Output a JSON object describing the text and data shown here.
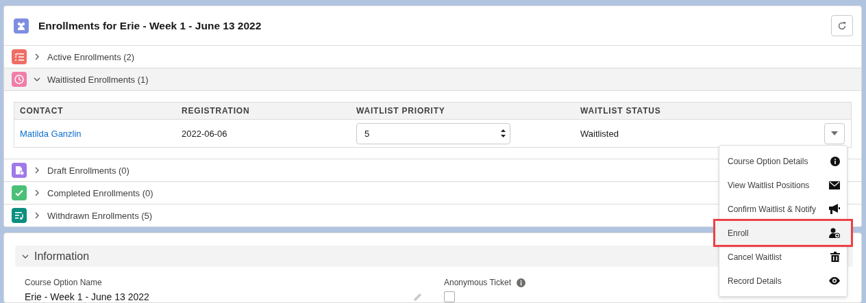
{
  "header": {
    "title": "Enrollments for Erie - Week 1 - June 13 2022"
  },
  "sections": [
    {
      "kind": "list",
      "color": "#ef6e64",
      "label": "Active Enrollments (2)",
      "expanded": false
    },
    {
      "kind": "clock",
      "color": "#f07ea8",
      "label": "Waitlisted Enrollments (1)",
      "expanded": true,
      "table": {
        "columns": [
          "CONTACT",
          "REGISTRATION",
          "WAITLIST PRIORITY",
          "WAITLIST STATUS"
        ],
        "rows": [
          {
            "contact": "Matilda Ganzlin",
            "registration": "2022-06-06",
            "priority": "5",
            "status": "Waitlisted"
          }
        ]
      }
    },
    {
      "kind": "draft",
      "color": "#9f7ae8",
      "label": "Draft Enrollments (0)",
      "expanded": false
    },
    {
      "kind": "check",
      "color": "#4bc076",
      "label": "Completed Enrollments (0)",
      "expanded": false
    },
    {
      "kind": "withdrawn",
      "color": "#0b8f7f",
      "label": "Withdrawn Enrollments (5)",
      "expanded": false
    }
  ],
  "menu": [
    {
      "kind": "info",
      "label": "Course Option Details",
      "selected": false
    },
    {
      "kind": "mail",
      "label": "View Waitlist Positions",
      "selected": false
    },
    {
      "kind": "megaphone",
      "label": "Confirm Waitlist & Notify",
      "selected": false
    },
    {
      "kind": "enroll",
      "label": "Enroll",
      "selected": true
    },
    {
      "kind": "trash",
      "label": "Cancel Waitlist",
      "selected": false
    },
    {
      "kind": "eye",
      "label": "Record Details",
      "selected": false
    }
  ],
  "information": {
    "title": "Information",
    "expanded": true,
    "fields": [
      {
        "kind": "text",
        "label": "Course Option Name",
        "value": "Erie - Week 1 - June 13 2022"
      },
      {
        "kind": "checkbox",
        "label": "Anonymous Ticket",
        "checked": false
      }
    ]
  }
}
